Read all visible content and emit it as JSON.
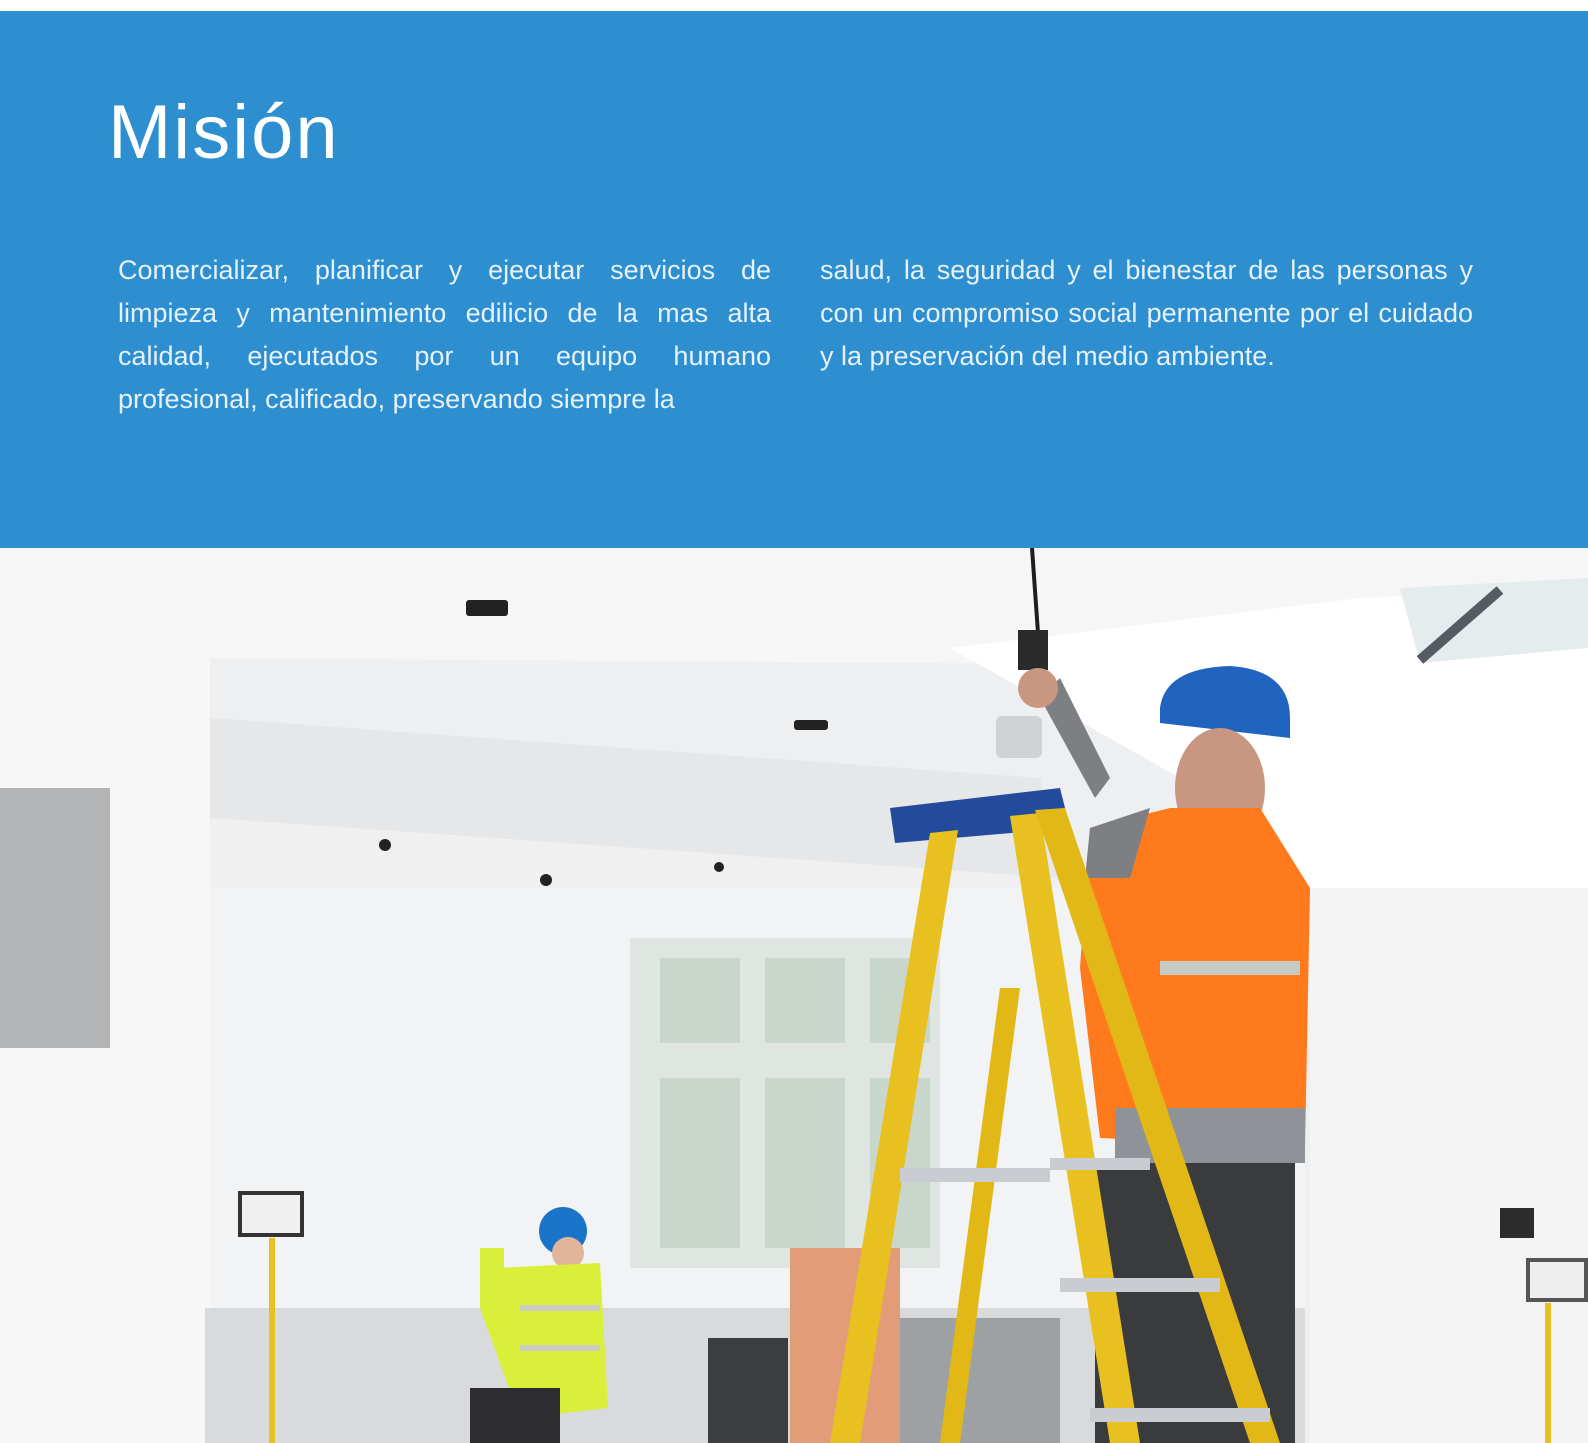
{
  "section": {
    "title": "Misión",
    "paragraph_left": "Comercializar, planificar y ejecutar servicios de limpieza y  mantenimiento edilicio de la mas alta calidad, ejecutados por un equipo humano profesional, calificado, preservando siempre la",
    "paragraph_right": "salud, la seguridad y el bienestar de las personas y con un compromiso social permanente por el cuidado y la preservación del medio ambiente."
  },
  "colors": {
    "brand_blue": "#2d8fd0",
    "text_light": "#e6f1fa"
  },
  "photo": {
    "icon": "worker-on-ladder-photo"
  }
}
